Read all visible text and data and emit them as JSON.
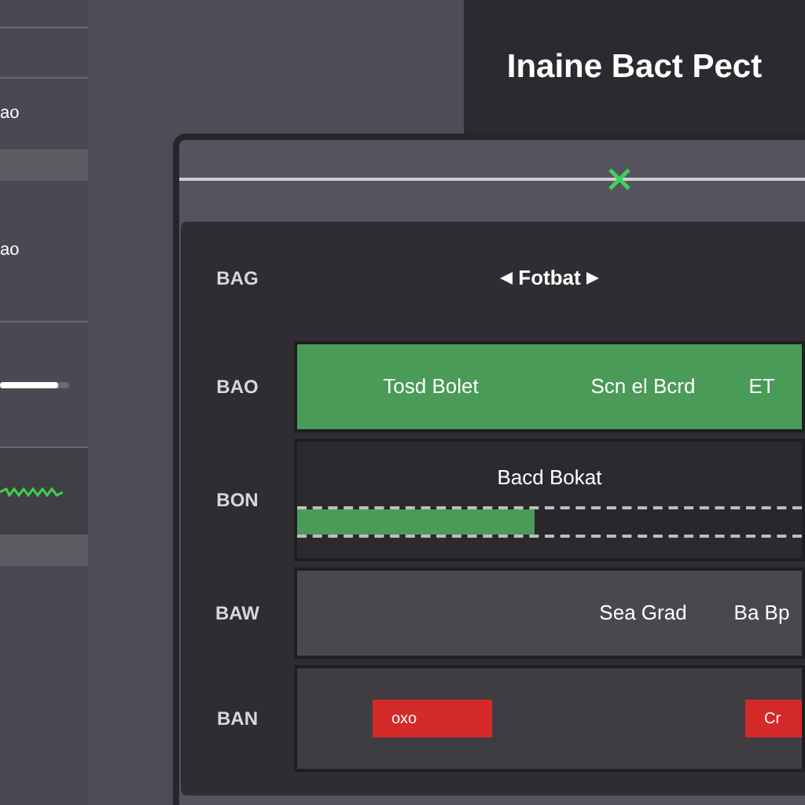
{
  "title": "Inaine Bact Pect",
  "sidebar": {
    "labels": [
      "ao",
      "ao"
    ],
    "slider": {
      "level": 0.85
    }
  },
  "panel": {
    "rows": [
      {
        "label": "BAG",
        "kind": "header",
        "title": "Fotbat"
      },
      {
        "label": "BAO",
        "kind": "cells",
        "selected": true,
        "cells": [
          "Tosd Bolet",
          "Scn el Bcrd",
          "ET"
        ]
      },
      {
        "label": "BON",
        "kind": "progress",
        "title": "Bacd Bokat",
        "level": 0.47
      },
      {
        "label": "BAW",
        "kind": "cells",
        "selected": false,
        "cells": [
          "Sea Grad",
          "Ba Bp"
        ]
      },
      {
        "label": "BAN",
        "kind": "buttons",
        "buttons": [
          "oxo",
          "Cr"
        ]
      }
    ]
  }
}
